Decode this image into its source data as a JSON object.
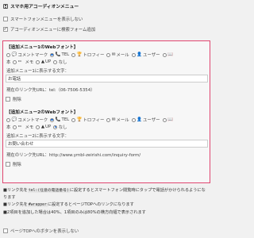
{
  "header": {
    "title": "スマホ用アコーディオンメニュー"
  },
  "options": {
    "hide_smartphone_menu": "スマートフォンメニューを表示しない",
    "add_search_form": "アコーディオンメニューに検索フォーム追加"
  },
  "icon_options_row1": [
    {
      "glyph": "💬",
      "label": "コメントマーク",
      "selected": false
    },
    {
      "glyph": "📞",
      "label": "TEL",
      "selected": true
    },
    {
      "glyph": "🏆",
      "label": "トロフィー",
      "selected": false
    },
    {
      "glyph": "✉",
      "label": "メール",
      "selected": false
    },
    {
      "glyph": "👤",
      "label": "ユーザー",
      "selected": false
    },
    {
      "glyph": "📖",
      "label": "",
      "selected": false
    }
  ],
  "icon_options_row2": [
    {
      "glyph": "",
      "label": "本",
      "selected": false,
      "no_radio": true
    },
    {
      "glyph": "✏",
      "label": "",
      "selected": false
    },
    {
      "glyph": "",
      "label": "メモ",
      "selected": false,
      "no_radio": true
    },
    {
      "glyph": "▲",
      "label": "UP",
      "selected": false
    },
    {
      "glyph": "",
      "label": "なし",
      "selected": false
    }
  ],
  "icon_options2_row2": [
    {
      "glyph": "",
      "label": "本",
      "selected": false,
      "no_radio": true
    },
    {
      "glyph": "✏",
      "label": "",
      "selected": false
    },
    {
      "glyph": "",
      "label": "メモ",
      "selected": false,
      "no_radio": true
    },
    {
      "glyph": "▲",
      "label": "UP",
      "selected": false
    },
    {
      "glyph": "",
      "label": "なし",
      "selected": true
    }
  ],
  "menu1": {
    "title": "【追加メニュー1のWebフォント】",
    "text_label": "追加メニュー1に表示する文字：",
    "text_value": "お電話",
    "link_label": "現在のリンク先URL：",
    "link_value": "tel:（06-7506-5354）",
    "delete_label": "削除"
  },
  "menu2": {
    "title": "【追加メニュー2のWebフォント】",
    "text_label": "追加メニュー2に表示する文字：",
    "text_value": "お問い合わせ",
    "link_label": "現在のリンク先URL：",
    "link_value": "http://www.ymbl-zeirishi.com/inquiry-form/",
    "delete_label": "削除"
  },
  "notes": {
    "n1_a": "■リンク先を",
    "n1_code": "tel:(任意の電話番号)",
    "n1_b": "に設定するとスマートフォン閲覧時にタップで電話がかけられるようになります",
    "n2_a": "■リンク先を",
    "n2_code": "#wrapper",
    "n2_b": "に設定するとページTOPへのリンクになります",
    "n3": "■2項目を追加した場合は40%、1項目のみは80%の横方向幅で表示されます"
  },
  "bottom_option": "ページTOPへのボタンを表示しない"
}
